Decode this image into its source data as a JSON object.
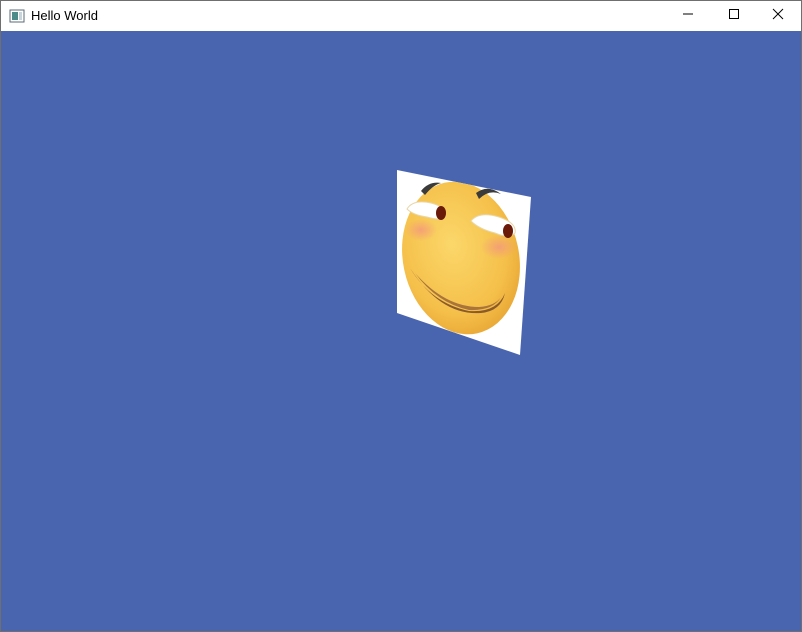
{
  "window": {
    "title": "Hello World",
    "controls": {
      "minimize": "minimize-icon",
      "maximize": "maximize-icon",
      "close": "close-icon"
    }
  },
  "scene": {
    "background_color": "#4a65b0",
    "object": "smiling-emoji-textured-quad",
    "face_color": "#f5c04a",
    "blush_color": "#f4a07a"
  }
}
